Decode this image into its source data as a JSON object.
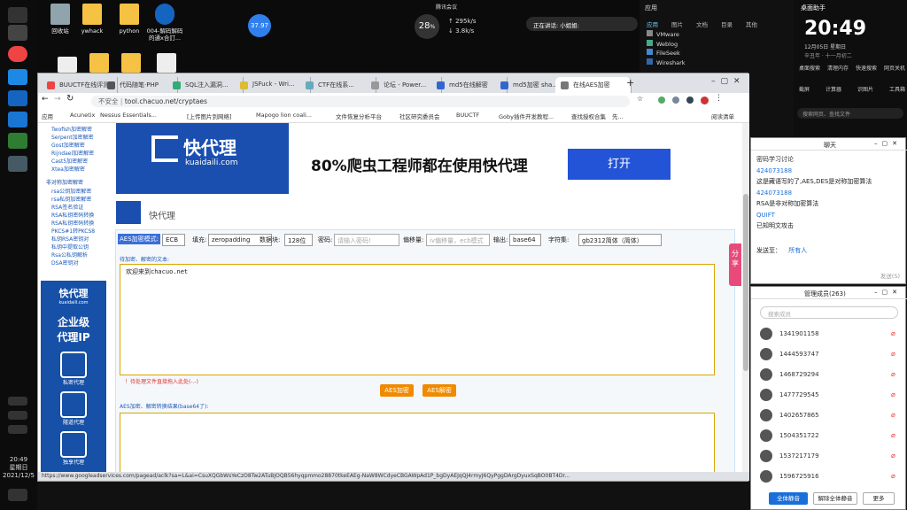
{
  "desktop": {
    "icons": [
      "回收站",
      "ywhack",
      "python",
      "004-解码解码\n的通x合訂..."
    ],
    "speed_badge": "37.97",
    "cpu_badge": "28",
    "cpu_unit": "%",
    "net_up": "↑ 295k/s",
    "net_down": "↓ 3.8k/s",
    "meeting_label": "腾讯会议",
    "speaker_label": "正在讲话: 小姐姐:"
  },
  "taskbar": {
    "time": "20:49",
    "day": "星期日",
    "date": "2021/12/5"
  },
  "browser": {
    "tabs": [
      {
        "label": "BUUCTF在线评测"
      },
      {
        "label": "代码随笔·PHP"
      },
      {
        "label": "SQL注入漏洞..."
      },
      {
        "label": "JSFuck - Wri..."
      },
      {
        "label": "CTF在线系..."
      },
      {
        "label": "论坛 - Power..."
      },
      {
        "label": "md5在线解密"
      },
      {
        "label": "md5加密 sha..."
      },
      {
        "label": "在线AES加密"
      }
    ],
    "new_tab": "+",
    "security_label": "不安全",
    "url": "tool.chacuo.net/cryptaes",
    "bookmarks": [
      "应用",
      "Acunetix",
      "Nessus Essentials...",
      "[上传图片到网络]",
      "Mapogo lion coali...",
      "文件恢复分析平台",
      "社区研究委员会",
      "BUUCTF",
      "Goby插件开发教程...",
      "查找授权合集",
      "先..."
    ],
    "reading_list": "阅读清单",
    "status_url": "https://www.googleadservices.com/pagead/aclk?sa=L&ai=CsuXQGbWsYeCzO8Tw2ATuBJOQB56hyqpmmo28870tkeEAEg-NaW8WCdyeCBGAWpAd1P_bgDyAEJqQJ4rmyJ6QyPggDArgDyuxSqBO0BT4Dr..."
  },
  "sidebar": {
    "links": [
      "Twofish加密解密",
      "Serpent加密解密",
      "Gost加密解密",
      "Rijndael加密解密",
      "Cast5加密解密",
      "Xtea加密解密"
    ],
    "section_title": "非对称加密解密",
    "links2": [
      "rsa公钥加密解密",
      "rsa私钥加密解密",
      "RSA签名验证",
      "RSA私钥密码转换",
      "RSA私钥密码转换",
      "PKCS#1转PKCS8",
      "私钥RSA密钥对",
      "私钥中提取公钥",
      "Rsa公私钥解析",
      "DSA密钥对"
    ],
    "ad": {
      "brand": "快代理",
      "domain": "kuaidaili.com",
      "title1": "企业级",
      "title2": "代理IP",
      "items": [
        "私密代理",
        "隧道代理",
        "独享代理"
      ]
    }
  },
  "ad_banner": {
    "brand": "快代理",
    "domain": "kuaidaili.com",
    "headline": "80%爬虫工程师都在使用快代理",
    "cta": "打开"
  },
  "site": {
    "name": "快代理"
  },
  "tool": {
    "aes_label": "AES加密模式:",
    "mode_value": "ECB",
    "padding_label": "填充:",
    "padding_value": "zeropadding",
    "block_label": "数据块:",
    "block_value": "128位",
    "password_label": "密码:",
    "password_placeholder": "请输入密码!",
    "iv_label": "偏移量:",
    "iv_placeholder": "iv偏移量，ecb模式",
    "output_label": "输出:",
    "output_value": "base64",
    "charset_label": "字符集:",
    "charset_value": "gb2312简体（简体）",
    "input_hint": "待加密、解密的文本:",
    "input_value": "欢迎来到chacuo.net",
    "warning": "！待处理文件直接拖入此处(-.-)",
    "encrypt_btn": "AES加密",
    "decrypt_btn": "AES解密",
    "output_hint": "AES加密、解密转换结果(base64了):",
    "share": "分享"
  },
  "right_top": {
    "title": "应用",
    "tabs": [
      "应用",
      "图片",
      "文档",
      "目录",
      "其他"
    ],
    "apps": [
      "VMware",
      "Weblog",
      "FileSeek",
      "Wireshark"
    ]
  },
  "clock_panel": {
    "title": "桌面助手",
    "time": "20:49",
    "date": "12月05日  星期日",
    "lunar": "辛丑年 · 十一月初二",
    "tools": [
      "桌面搜索",
      "清理内存",
      "快速搜索",
      "网页关机"
    ],
    "tools2": [
      "截屏",
      "计算器",
      "识图片",
      "工具箱"
    ],
    "search": "搜索网页、查找文件"
  },
  "chat": {
    "title": "聊天",
    "messages": [
      {
        "user": "密码学习讨论",
        "text": ""
      },
      {
        "user": "424073188",
        "text": "这是藏语写的了,AES,DES是对称加密算法"
      },
      {
        "user": "424073188",
        "text": "RSA是非对称加密算法"
      },
      {
        "user": "QUIFT",
        "text": "已知明文攻击"
      }
    ],
    "send_to": "发送至：",
    "send_target": "所有人",
    "send_btn": "发送(S)"
  },
  "members": {
    "title": "管理成员(263)",
    "search_placeholder": "搜索成员",
    "list": [
      "1341901158",
      "1444593747",
      "1468729294",
      "1477729545",
      "1402657865",
      "1504351722",
      "1537217179",
      "1596725916"
    ],
    "mute_all": "全体静音",
    "unmute_all": "解除全体静音",
    "more": "更多"
  },
  "colors": {
    "accent": "#1a4fb0",
    "orange": "#f08a00",
    "link": "#1b58b8"
  }
}
